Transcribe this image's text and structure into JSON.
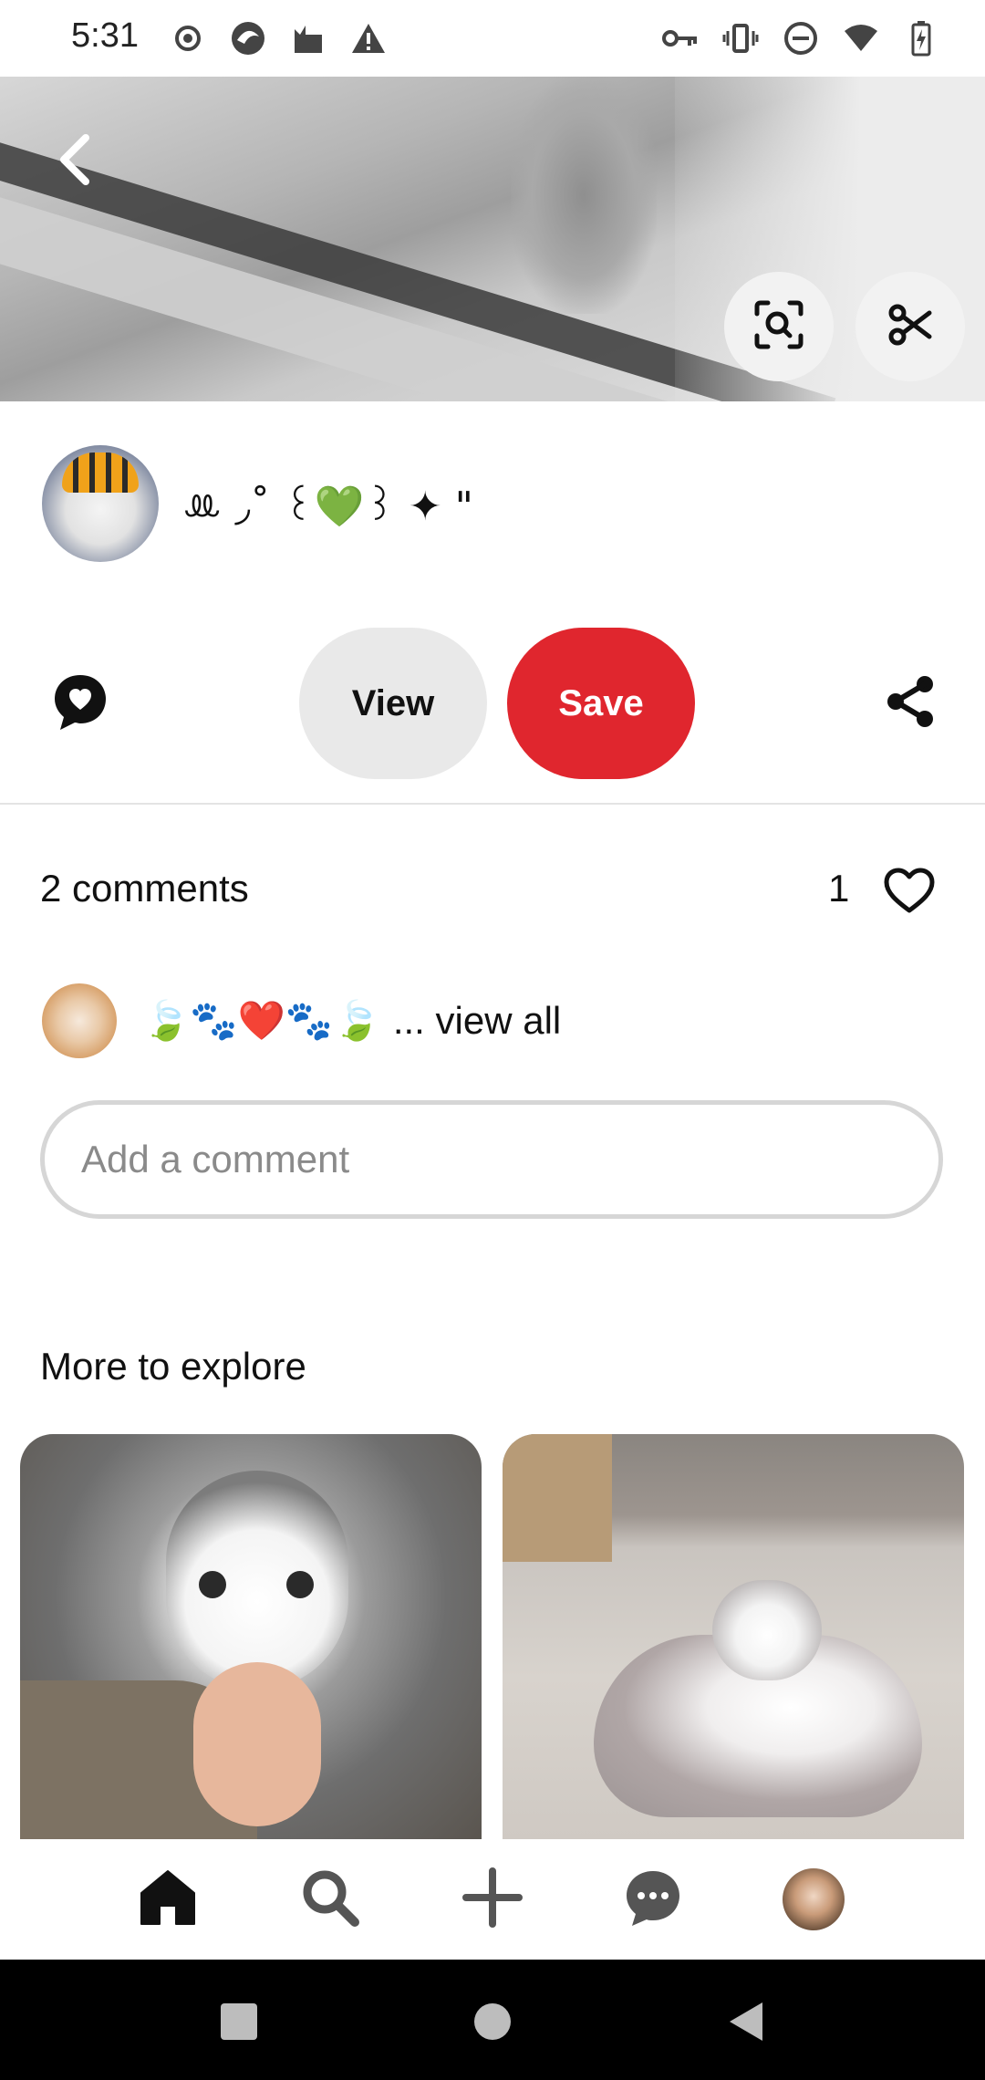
{
  "status_bar": {
    "time": "5:31",
    "left_icons": [
      "record-icon",
      "browser-icon",
      "cat-app-icon",
      "warning-icon"
    ],
    "right_icons": [
      "vpn-key-icon",
      "vibrate-icon",
      "dnd-icon",
      "wifi-icon",
      "battery-charging-icon"
    ]
  },
  "hero": {
    "back_icon": "chevron-left-icon",
    "lens_icon": "visual-search-icon",
    "cut_icon": "scissors-icon"
  },
  "creator": {
    "name": "ꔛ ◞˚ ꒰💚꒱ ✦ \""
  },
  "actions": {
    "comment_icon": "comment-heart-icon",
    "view_label": "View",
    "save_label": "Save",
    "share_icon": "share-icon",
    "save_color": "#e0262e"
  },
  "comments": {
    "header": "2 comments",
    "like_count": "1",
    "preview_emoji": "🍃🐾❤️🐾🍃",
    "view_all": "... view all",
    "input_placeholder": "Add a comment"
  },
  "explore": {
    "title": "More to explore"
  },
  "bottom_nav": {
    "items": [
      "home-icon",
      "search-icon",
      "create-icon",
      "messages-icon",
      "profile-avatar"
    ]
  },
  "system_nav": {
    "items": [
      "recents-icon",
      "home-circle-icon",
      "back-triangle-icon"
    ]
  }
}
